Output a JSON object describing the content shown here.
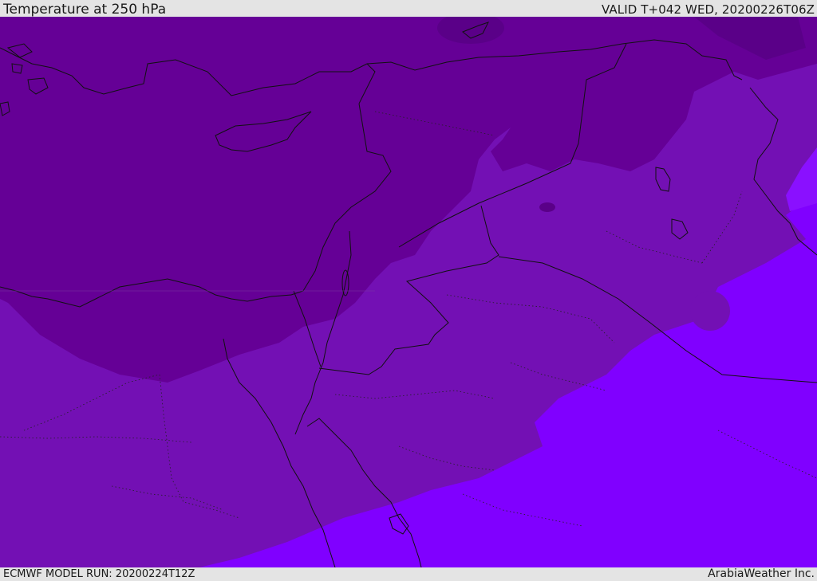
{
  "header": {
    "title": "Temperature at 250 hPa",
    "valid_time": "VALID T+042 WED, 20200226T06Z"
  },
  "footer": {
    "model_run": "ECMWF MODEL RUN: 20200224T12Z",
    "credit": "ArabiaWeather Inc."
  },
  "map": {
    "colors": {
      "coldest_band": "#650096",
      "cold_band": "#7310b4",
      "mid_band": "#8000ff",
      "coastline": "#111111"
    }
  }
}
